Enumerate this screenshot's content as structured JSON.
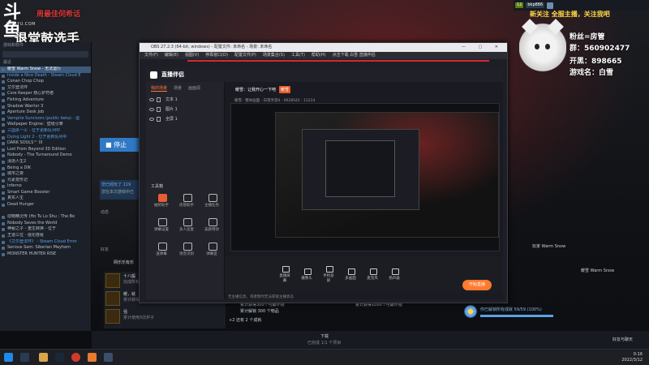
{
  "overlay": {
    "logo": "斗鱼",
    "logo_sub": "DOUYU.COM",
    "banner": "周最佳伺希话",
    "streamer_name": "退堂鼓选手",
    "announce": "新关注 全服主播，关注我吧",
    "lines": [
      "粉丝=房管",
      "群：560902477",
      "开黑：898665",
      "游戏名：白雪"
    ]
  },
  "steam": {
    "top_badges": [
      "12",
      "bkp886"
    ],
    "section_label": "游戏和软件",
    "recent_label": "最近",
    "games": [
      {
        "name": "暖雪 Warm Snow - 无法运行",
        "style": "hl"
      },
      {
        "name": "Inside a Nice Death - Steam Cloud E",
        "style": "blue"
      },
      {
        "name": "Conan Chop Chop",
        "style": ""
      },
      {
        "name": "艾尔登法环",
        "style": ""
      },
      {
        "name": "Core Keeper 核心护符者",
        "style": ""
      },
      {
        "name": "Fishing Adventure",
        "style": ""
      },
      {
        "name": "Shadow Warrior 3",
        "style": ""
      },
      {
        "name": "Aperture Desk Job",
        "style": ""
      },
      {
        "name": "Vampire Survivors (public beta) - 运",
        "style": "blue"
      },
      {
        "name": "Wallpaper Engine：壁纸引擎",
        "style": ""
      },
      {
        "name": "三国杀一火 - 位于更新队列中",
        "style": "blue"
      },
      {
        "name": "Dying Light 2 - 位于更新队列中",
        "style": "blue"
      },
      {
        "name": "DARK SOULS™ III",
        "style": ""
      },
      {
        "name": "Lost From Beyond 3D Edition",
        "style": ""
      },
      {
        "name": "Nobody - The Turnaround Demo",
        "style": ""
      },
      {
        "name": "消逝人生2",
        "style": ""
      },
      {
        "name": "Being a DIK",
        "style": ""
      },
      {
        "name": "城市之夜",
        "style": ""
      },
      {
        "name": "元素变形记",
        "style": ""
      },
      {
        "name": "Inferno",
        "style": ""
      },
      {
        "name": "Smart Game Booster",
        "style": ""
      },
      {
        "name": "真实人生",
        "style": ""
      },
      {
        "name": "Dead Hunger",
        "style": ""
      },
      {
        "name": "",
        "style": ""
      },
      {
        "name": "动物精灵传 (Ho Tu Lo Shu : The Bo",
        "style": ""
      },
      {
        "name": "Nobody Saves the World",
        "style": ""
      },
      {
        "name": "神秘之子 - 重生转换 - 位于",
        "style": ""
      },
      {
        "name": "王道三位 · 强化搭组",
        "style": ""
      },
      {
        "name": "《艾尔登法环》 - Steam Cloud Error",
        "style": "blue"
      },
      {
        "name": "Serious Sam: Siberian Mayhem",
        "style": ""
      },
      {
        "name": "MONSTER HUNTER RISE",
        "style": ""
      }
    ],
    "stop_button": "停止",
    "panel_text": [
      "您已经玩了 119",
      "您在本次游戏中已"
    ],
    "dynamic_label": "动态",
    "friends_label": "好友",
    "friend_title": "网乐乐有乐",
    "achievement_items": [
      {
        "title": "十八般",
        "sub": "完成所有武器的升级"
      },
      {
        "title": "暖，就",
        "sub": "累计获得300个可破坏物"
      },
      {
        "title": "强",
        "sub": "累计使用3次炉子"
      }
    ],
    "achievement_mid": [
      "累计获得300个可破坏物",
      "累计解锁 300 个物品",
      "+2 还有 2 个成就"
    ],
    "achievement_right": "累计获得1000个可破坏物",
    "right_list": [
      "玩家 Warm Snow",
      "暖雪 Warm Snow"
    ],
    "progress_text": "你已解锁所有成就 59/59 (100%)",
    "download": {
      "label": "下载",
      "sub": "已完成 1/1 个项目"
    },
    "friends_chat": "好友与聊天"
  },
  "obs": {
    "title": "OBS 27.2.3 (64-bit, windows) - 配置文件: 未命名 - 场景: 未命名",
    "menu": [
      "文件(F)",
      "编辑(E)",
      "视图(V)",
      "停靠窗口(D)",
      "配置文件(P)",
      "场景集合(S)",
      "工具(T)",
      "帮助(H)",
      "点击下载 白雪 直播伴侣"
    ]
  },
  "companion": {
    "brand": "直播伴侣",
    "tabs": [
      "我的场景",
      "场景",
      "画面源"
    ],
    "scenes": [
      "文本 1",
      "图片 1",
      "全屏 1"
    ],
    "tools_label": "工具箱",
    "tools": [
      "抽奖助手",
      "房管助手",
      "主播任务",
      "弹幕设置",
      "多人连麦",
      "美颜特效",
      "送弹幕",
      "语音识别",
      "弹幕室"
    ],
    "live_title": "暖雪：让我开心一下吧",
    "live_tag": "暖雪",
    "live_sub": "暖雪 · 整体画面 · 白雪手游4 · 9628542 · 11214",
    "bottom_items": [
      "直播屏幕",
      "摄像头",
      "手机投屏",
      "多画面",
      "麦克风",
      "扬声器"
    ],
    "start_button": "开始直播",
    "status": "无主播信息，或者暂时无法获取主播状态"
  },
  "taskbar": {
    "time": "0:16",
    "date": "2022/3/12"
  }
}
